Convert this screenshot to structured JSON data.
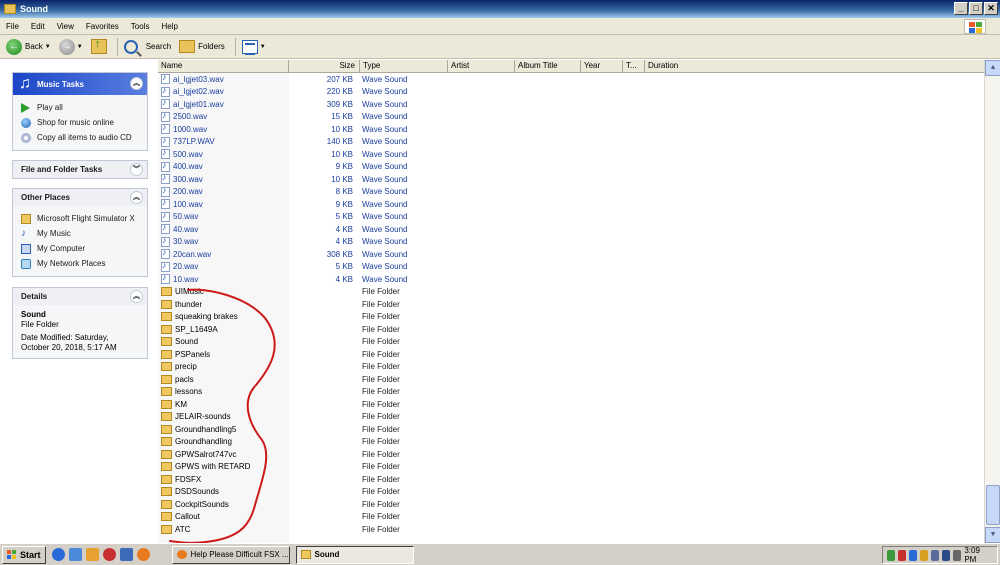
{
  "window": {
    "title": "Sound"
  },
  "menu": [
    "File",
    "Edit",
    "View",
    "Favorites",
    "Tools",
    "Help"
  ],
  "toolbar": {
    "back": "Back",
    "search": "Search",
    "folders": "Folders"
  },
  "left": {
    "music_tasks": {
      "title": "Music Tasks",
      "items": [
        "Play all",
        "Shop for music online",
        "Copy all items to audio CD"
      ]
    },
    "file_folder_tasks": {
      "title": "File and Folder Tasks"
    },
    "other_places": {
      "title": "Other Places",
      "items": [
        "Microsoft Flight Simulator X",
        "My Music",
        "My Computer",
        "My Network Places"
      ]
    },
    "details": {
      "title": "Details",
      "name": "Sound",
      "type": "File Folder",
      "modified": "Date Modified: Saturday, October 20, 2018, 5:17 AM"
    }
  },
  "columns": [
    "Name",
    "Size",
    "Type",
    "Artist",
    "Album Title",
    "Year",
    "T...",
    "Duration"
  ],
  "files": [
    {
      "name": "ai_lgjet03.wav",
      "size": "207 KB",
      "type": "Wave Sound",
      "kind": "wav"
    },
    {
      "name": "ai_lgjet02.wav",
      "size": "220 KB",
      "type": "Wave Sound",
      "kind": "wav"
    },
    {
      "name": "ai_lgjet01.wav",
      "size": "309 KB",
      "type": "Wave Sound",
      "kind": "wav"
    },
    {
      "name": "2500.wav",
      "size": "15 KB",
      "type": "Wave Sound",
      "kind": "wav"
    },
    {
      "name": "1000.wav",
      "size": "10 KB",
      "type": "Wave Sound",
      "kind": "wav"
    },
    {
      "name": "737LP.WAV",
      "size": "140 KB",
      "type": "Wave Sound",
      "kind": "wav"
    },
    {
      "name": "500.wav",
      "size": "10 KB",
      "type": "Wave Sound",
      "kind": "wav"
    },
    {
      "name": "400.wav",
      "size": "9 KB",
      "type": "Wave Sound",
      "kind": "wav"
    },
    {
      "name": "300.wav",
      "size": "10 KB",
      "type": "Wave Sound",
      "kind": "wav"
    },
    {
      "name": "200.wav",
      "size": "8 KB",
      "type": "Wave Sound",
      "kind": "wav"
    },
    {
      "name": "100.wav",
      "size": "9 KB",
      "type": "Wave Sound",
      "kind": "wav"
    },
    {
      "name": "50.wav",
      "size": "5 KB",
      "type": "Wave Sound",
      "kind": "wav"
    },
    {
      "name": "40.wav",
      "size": "4 KB",
      "type": "Wave Sound",
      "kind": "wav"
    },
    {
      "name": "30.wav",
      "size": "4 KB",
      "type": "Wave Sound",
      "kind": "wav"
    },
    {
      "name": "20can.wav",
      "size": "308 KB",
      "type": "Wave Sound",
      "kind": "wav"
    },
    {
      "name": "20.wav",
      "size": "5 KB",
      "type": "Wave Sound",
      "kind": "wav"
    },
    {
      "name": "10.wav",
      "size": "4 KB",
      "type": "Wave Sound",
      "kind": "wav"
    },
    {
      "name": "UIMusic",
      "size": "",
      "type": "File Folder",
      "kind": "folder"
    },
    {
      "name": "thunder",
      "size": "",
      "type": "File Folder",
      "kind": "folder"
    },
    {
      "name": "squeaking brakes",
      "size": "",
      "type": "File Folder",
      "kind": "folder"
    },
    {
      "name": "SP_L1649A",
      "size": "",
      "type": "File Folder",
      "kind": "folder"
    },
    {
      "name": "Sound",
      "size": "",
      "type": "File Folder",
      "kind": "folder"
    },
    {
      "name": "PSPanels",
      "size": "",
      "type": "File Folder",
      "kind": "folder"
    },
    {
      "name": "precip",
      "size": "",
      "type": "File Folder",
      "kind": "folder"
    },
    {
      "name": "pacls",
      "size": "",
      "type": "File Folder",
      "kind": "folder"
    },
    {
      "name": "lessons",
      "size": "",
      "type": "File Folder",
      "kind": "folder"
    },
    {
      "name": "KM",
      "size": "",
      "type": "File Folder",
      "kind": "folder"
    },
    {
      "name": "JELAIR-sounds",
      "size": "",
      "type": "File Folder",
      "kind": "folder"
    },
    {
      "name": "Groundhandling5",
      "size": "",
      "type": "File Folder",
      "kind": "folder"
    },
    {
      "name": "Groundhandling",
      "size": "",
      "type": "File Folder",
      "kind": "folder"
    },
    {
      "name": "GPWSalrot747vc",
      "size": "",
      "type": "File Folder",
      "kind": "folder"
    },
    {
      "name": "GPWS with RETARD",
      "size": "",
      "type": "File Folder",
      "kind": "folder"
    },
    {
      "name": "FDSFX",
      "size": "",
      "type": "File Folder",
      "kind": "folder"
    },
    {
      "name": "DSDSounds",
      "size": "",
      "type": "File Folder",
      "kind": "folder"
    },
    {
      "name": "CockpitSounds",
      "size": "",
      "type": "File Folder",
      "kind": "folder"
    },
    {
      "name": "Callout",
      "size": "",
      "type": "File Folder",
      "kind": "folder"
    },
    {
      "name": "ATC",
      "size": "",
      "type": "File Folder",
      "kind": "folder"
    }
  ],
  "taskbar": {
    "start": "Start",
    "tasks": [
      "Help Please Difficult FSX ...",
      "Sound"
    ],
    "clock": "3:09 PM"
  },
  "colors": {
    "annotation": "#cc1a1a",
    "title_bar": "#0a246a",
    "link_text": "#1a3ea0"
  }
}
